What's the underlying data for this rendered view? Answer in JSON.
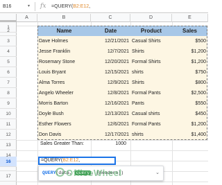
{
  "formula_bar": {
    "cell_ref": "B16",
    "fx_label": "fx",
    "formula_prefix": "=QUERY(",
    "formula_ref": "B2:E12",
    "formula_suffix": ","
  },
  "columns": [
    "A",
    "B",
    "C",
    "D",
    "E"
  ],
  "rows": [
    "1",
    "2",
    "3",
    "4",
    "5",
    "6",
    "7",
    "8",
    "9",
    "10",
    "11",
    "12",
    "13",
    "14",
    "15",
    "16",
    "17"
  ],
  "selected_row": "16",
  "table": {
    "headers": [
      "Name",
      "Date",
      "Product",
      "Sales"
    ],
    "rows": [
      [
        "Dave Holmes",
        "12/21/2021",
        "Casual Shirts",
        "$500"
      ],
      [
        "Jesse Franklin",
        "12/7/2021",
        "Shirts",
        "$1,200"
      ],
      [
        "Rosemary Stone",
        "12/20/2021",
        "Formal Shirts",
        "$1,200"
      ],
      [
        "Louis Bryant",
        "12/15/2021",
        "shirts",
        "$750"
      ],
      [
        "Alma Torres",
        "12/9/2021",
        "Shirts",
        "$800"
      ],
      [
        "Angelo Wheeler",
        "12/8/2021",
        "Formal Pants",
        "$2,500"
      ],
      [
        "Morris Barton",
        "12/16/2021",
        "Pants",
        "$550"
      ],
      [
        "Doyle Bush",
        "12/13/2021",
        "Casual shirts",
        "$450"
      ],
      [
        "Esther Flowers",
        "12/6/2021",
        "Formal Pants",
        "$1,200"
      ],
      [
        "Don Davis",
        "12/17/2021",
        "shirts",
        "$1,400"
      ]
    ]
  },
  "criteria": {
    "label": "Sales Greater Than:",
    "value": "1000"
  },
  "active_cell": {
    "prefix": "=QUERY(",
    "ref": "B2:E12",
    "suffix": ","
  },
  "tooltip": {
    "fn_name": "QUERY",
    "open": "(",
    "arg1": "data, ",
    "arg_highlight": "query",
    "rest": ", [headers])",
    "chevron": "⌄"
  },
  "watermark": "OfficeWheel",
  "colors": {
    "header_fill": "#a7c7e7",
    "row_fill": "#fdf6e3",
    "range_ref": "#e08a2c",
    "selection": "#1a73e8"
  }
}
